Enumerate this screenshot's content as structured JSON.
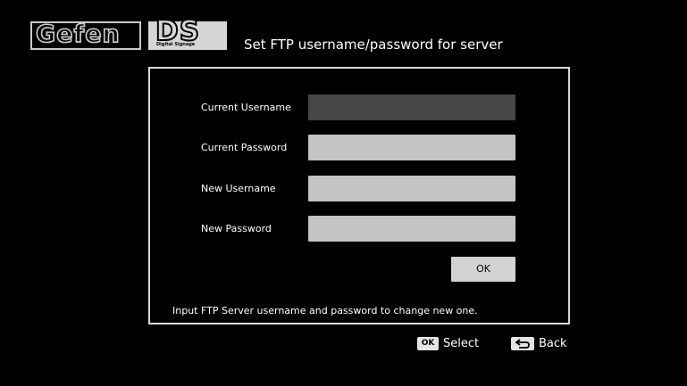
{
  "header": {
    "logo_gefen": "Gefen",
    "logo_ds": "DS",
    "logo_ds_sub": "Digital Signage",
    "title": "Set FTP username/password for server"
  },
  "form": {
    "fields": [
      {
        "label": "Current Username",
        "value": "",
        "state": "focused"
      },
      {
        "label": "Current Password",
        "value": ""
      },
      {
        "label": "New Username",
        "value": ""
      },
      {
        "label": "New Password",
        "value": ""
      }
    ],
    "ok_label": "OK",
    "hint": "Input FTP Server username and password to change new one."
  },
  "legend": {
    "ok_key": "OK",
    "ok_label": "Select",
    "back_label": "Back",
    "ok_icon": "ok-key-icon",
    "back_icon": "back-arrow-icon"
  },
  "colors": {
    "background": "#000000",
    "panel_border": "#d8d8d8",
    "input_fill": "#c4c4c4",
    "input_focused_fill": "#464646",
    "text": "#ffffff"
  }
}
